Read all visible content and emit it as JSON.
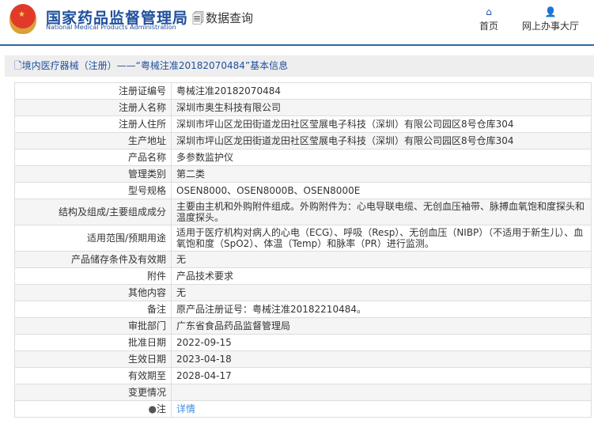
{
  "header": {
    "logo_cn": "国家药品监督管理局",
    "logo_en": "National Medical Products Administration",
    "data_query": "数据查询",
    "nav": [
      {
        "label": "首页",
        "icon": "home-icon"
      },
      {
        "label": "网上办事大厅",
        "icon": "user-icon"
      }
    ]
  },
  "breadcrumb": "境内医疗器械（注册）——“粤械注准20182070484”基本信息",
  "rows": [
    {
      "label": "注册证编号",
      "value": "粤械注准20182070484"
    },
    {
      "label": "注册人名称",
      "value": "深圳市奥生科技有限公司"
    },
    {
      "label": "注册人住所",
      "value": "深圳市坪山区龙田街道龙田社区莹展电子科技（深圳）有限公司园区8号仓库304"
    },
    {
      "label": "生产地址",
      "value": "深圳市坪山区龙田街道龙田社区莹展电子科技（深圳）有限公司园区8号仓库304"
    },
    {
      "label": "产品名称",
      "value": "多参数监护仪"
    },
    {
      "label": "管理类别",
      "value": "第二类"
    },
    {
      "label": "型号规格",
      "value": "OSEN8000、OSEN8000B、OSEN8000E"
    },
    {
      "label": "结构及组成/主要组成成分",
      "value": "主要由主机和外购附件组成。外购附件为：心电导联电缆、无创血压袖带、脉搏血氧饱和度探头和温度探头。"
    },
    {
      "label": "适用范围/预期用途",
      "value": "适用于医疗机构对病人的心电（ECG）、呼吸（Resp）、无创血压（NIBP）（不适用于新生儿）、血氧饱和度（SpO2）、体温（Temp）和脉率（PR）进行监测。"
    },
    {
      "label": "产品储存条件及有效期",
      "value": "无"
    },
    {
      "label": "附件",
      "value": "产品技术要求"
    },
    {
      "label": "其他内容",
      "value": "无"
    },
    {
      "label": "备注",
      "value": "原产品注册证号：粤械注准20182210484。"
    },
    {
      "label": "审批部门",
      "value": "广东省食品药品监督管理局"
    },
    {
      "label": "批准日期",
      "value": "2022-09-15"
    },
    {
      "label": "生效日期",
      "value": "2023-04-18"
    },
    {
      "label": "有效期至",
      "value": "2028-04-17"
    },
    {
      "label": "变更情况",
      "value": ""
    }
  ],
  "note": {
    "label": "注",
    "link": "详情"
  }
}
